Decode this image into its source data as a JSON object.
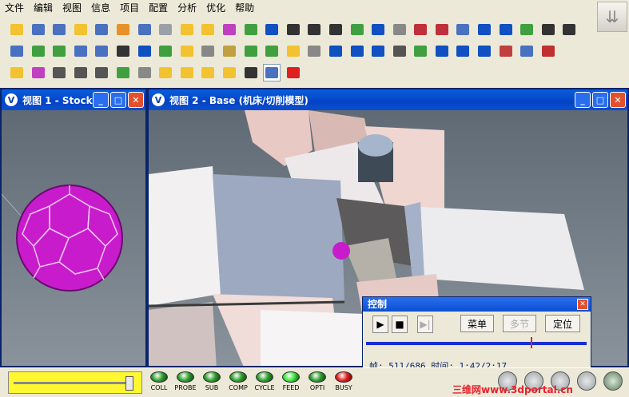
{
  "menu": [
    "文件",
    "编辑",
    "视图",
    "信息",
    "项目",
    "配置",
    "分析",
    "优化",
    "帮助"
  ],
  "toolbar_icon_colors": {
    "row1": [
      "#f2c230",
      "#4a70c0",
      "#4a70c0",
      "#f2c230",
      "#4a70c0",
      "#e8902a",
      "#4a70c0",
      "#9aa0a6",
      "#f2c230",
      "#f2c230",
      "#c040c0",
      "#40a040",
      "#1050c0",
      "#333",
      "#333",
      "#333",
      "#40a040",
      "#1050c0",
      "#888",
      "#c0303a",
      "#c0303a",
      "#4a70c0",
      "#1050c0",
      "#1050c0",
      "#40a040",
      "#333",
      "#333"
    ],
    "row2": [
      "#4a70c0",
      "#40a040",
      "#40a040",
      "#4a70c0",
      "#4a70c0",
      "#333",
      "#1050c0",
      "#40a040",
      "#f2c230",
      "#888",
      "#c0a040",
      "#40a040",
      "#40a040",
      "#f2c230",
      "#888",
      "#1050c0",
      "#1050c0",
      "#1050c0",
      "#555",
      "#40a040",
      "#1050c0",
      "#1050c0",
      "#1050c0",
      "#c04040",
      "#4a70c0",
      "#c03030"
    ],
    "row3": [
      "#f2c230",
      "#c040c0",
      "#555",
      "#555",
      "#555",
      "#40a040",
      "#888",
      "#f2c230",
      "#f2c230",
      "#f2c230",
      "#f2c230",
      "#333",
      "#4a70c0",
      "#e02020"
    ]
  },
  "view1": {
    "title": "视图 1 - Stock..."
  },
  "view2": {
    "title": "视图 2 - Base (机床/切削模型)"
  },
  "control": {
    "title": "控制",
    "menu_label": "菜单",
    "multi_label": "多节",
    "locate_label": "定位",
    "status": "帧: 511/686 时间: 1:42/2:17",
    "progress_pct": 74.5
  },
  "leds": [
    {
      "label": "COLL",
      "color": "#2fa02f"
    },
    {
      "label": "PROBE",
      "color": "#2fa02f"
    },
    {
      "label": "SUB",
      "color": "#2fa02f"
    },
    {
      "label": "COMP",
      "color": "#2fa02f"
    },
    {
      "label": "CYCLE",
      "color": "#2fa02f"
    },
    {
      "label": "FEED",
      "color": "#3ee83e"
    },
    {
      "label": "OPTI",
      "color": "#2fa02f"
    },
    {
      "label": "BUSY",
      "color": "#e02020"
    }
  ],
  "speed_slider_pct": 97,
  "watermark": "三维网www.3dportal.cn"
}
